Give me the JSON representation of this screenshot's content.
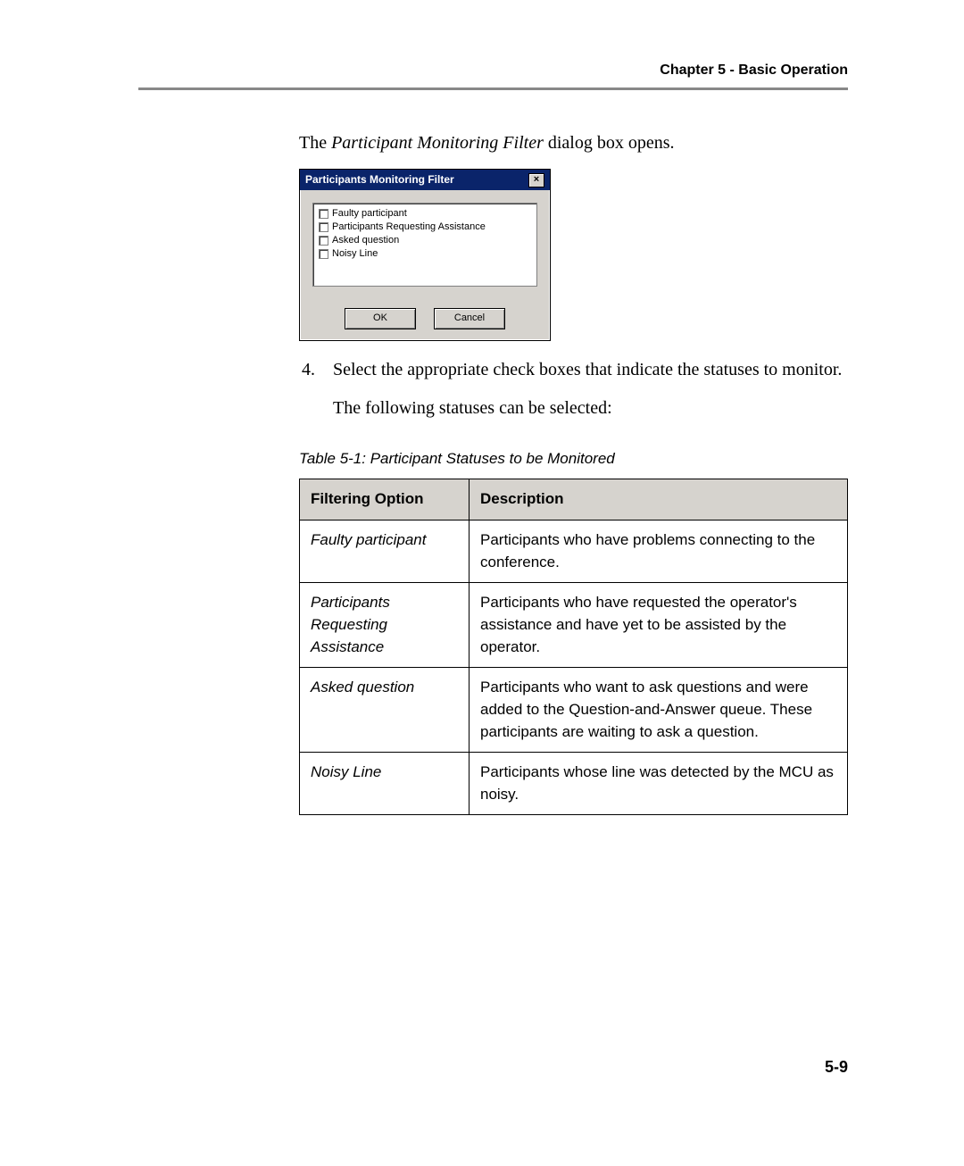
{
  "header": "Chapter 5 - Basic Operation",
  "intro": {
    "pre": "The ",
    "ital": "Participant Monitoring Filter",
    "post": " dialog box opens."
  },
  "dialog": {
    "title": "Participants Monitoring Filter",
    "close": "×",
    "options": [
      "Faulty participant",
      "Participants Requesting Assistance",
      "Asked question",
      "Noisy Line"
    ],
    "ok": "OK",
    "cancel": "Cancel"
  },
  "step4_num": "4.",
  "step4_text": "Select the appropriate check boxes that indicate the statuses to monitor.",
  "following_text": "The following statuses can be selected:",
  "table_caption": "Table 5-1: Participant Statuses to be Monitored",
  "table": {
    "headers": [
      "Filtering Option",
      "Description"
    ],
    "rows": [
      {
        "option": "Faulty participant",
        "desc": "Participants who have problems connecting to the conference."
      },
      {
        "option": "Participants Requesting Assistance",
        "desc": "Participants who have requested the operator's assistance and have yet to be assisted by the operator."
      },
      {
        "option": "Asked question",
        "desc": "Participants who want to ask questions and were added to the Question-and-Answer queue. These participants are waiting to ask a question."
      },
      {
        "option": "Noisy Line",
        "desc": "Participants whose line was detected by the MCU as noisy."
      }
    ]
  },
  "page_number": "5-9"
}
